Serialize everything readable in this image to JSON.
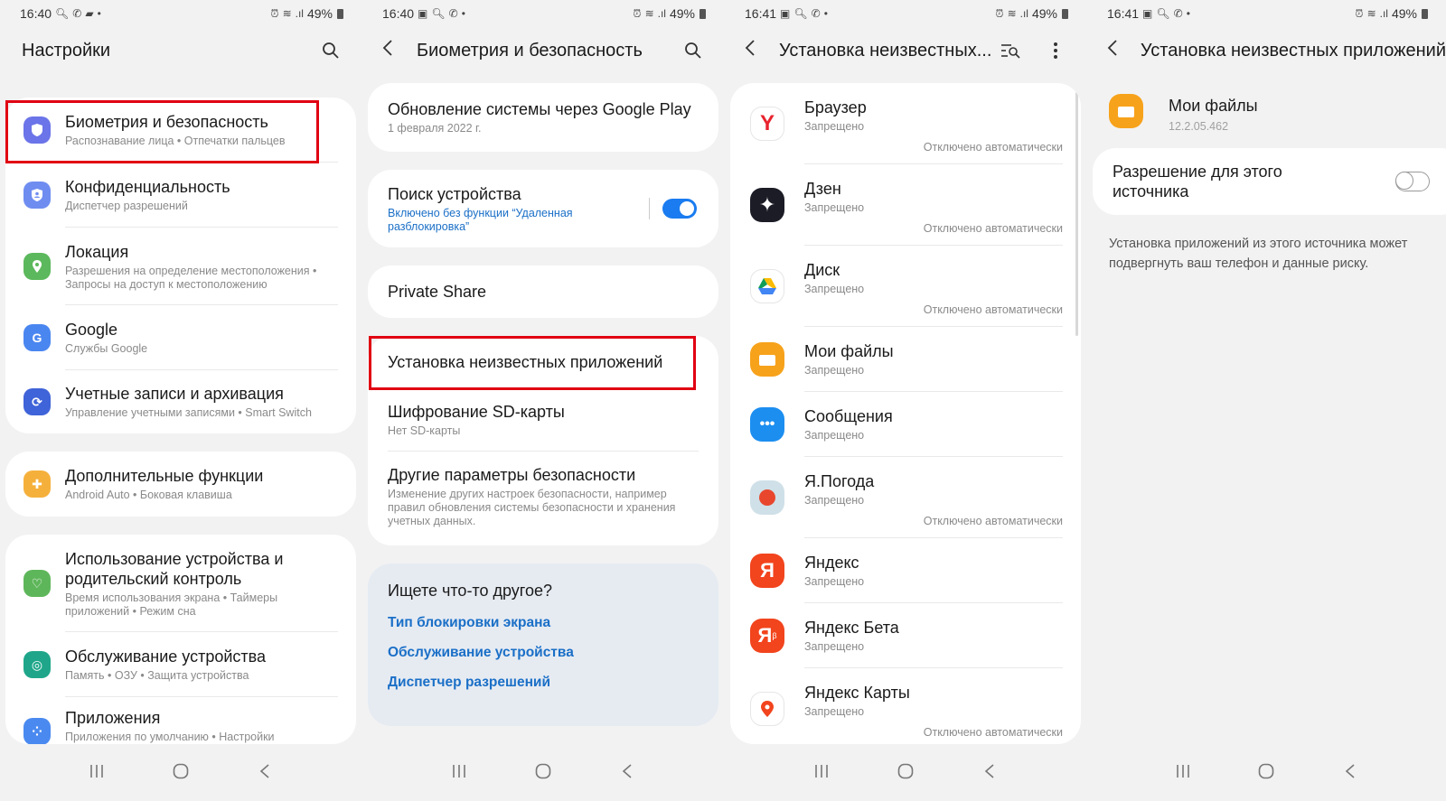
{
  "panels": [
    {
      "status": {
        "time": "16:40",
        "battery": "49%"
      },
      "title": "Настройки",
      "items": [
        {
          "title": "Биометрия и безопасность",
          "subtitle": "Распознавание лица  •  Отпечатки пальцев",
          "icon": "shield-icon",
          "color": "#6b74e8"
        },
        {
          "title": "Конфиденциальность",
          "subtitle": "Диспетчер разрешений",
          "icon": "privacy-icon",
          "color": "#6f8df0"
        },
        {
          "title": "Локация",
          "subtitle": "Разрешения на определение местоположения  •  Запросы на доступ к местоположению",
          "icon": "location-icon",
          "color": "#5cb85c"
        },
        {
          "title": "Google",
          "subtitle": "Службы Google",
          "icon": "google-icon",
          "color": "#4a86f0"
        },
        {
          "title": "Учетные записи и архивация",
          "subtitle": "Управление учетными записями  •  Smart Switch",
          "icon": "sync-icon",
          "color": "#3f63d8"
        },
        {
          "title": "Дополнительные функции",
          "subtitle": "Android Auto  •  Боковая клавиша",
          "icon": "gear-plus-icon",
          "color": "#f5b03c"
        },
        {
          "title": "Использование устройства и родительский контроль",
          "subtitle": "Время использования экрана  •  Таймеры приложений  •  Режим сна",
          "icon": "wellbeing-icon",
          "color": "#5eb65a"
        },
        {
          "title": "Обслуживание устройства",
          "subtitle": "Память  •  ОЗУ  •  Защита устройства",
          "icon": "care-icon",
          "color": "#1fa68a"
        },
        {
          "title": "Приложения",
          "subtitle": "Приложения по умолчанию  •  Настройки",
          "icon": "apps-icon",
          "color": "#4a8af0"
        }
      ]
    },
    {
      "status": {
        "time": "16:40",
        "battery": "49%"
      },
      "title": "Биометрия и безопасность",
      "gp_update": {
        "title": "Обновление системы через Google Play",
        "subtitle": "1 февраля 2022 г."
      },
      "find_device": {
        "title": "Поиск устройства",
        "subtitle": "Включено без функции “Удаленная разблокировка”",
        "enabled": true
      },
      "private_share": {
        "title": "Private Share"
      },
      "unknown_apps": {
        "title": "Установка неизвестных приложений"
      },
      "sd_encrypt": {
        "title": "Шифрование SD-карты",
        "subtitle": "Нет SD-карты"
      },
      "other_security": {
        "title": "Другие параметры безопасности",
        "subtitle": "Изменение других настроек безопасности, например правил обновления системы безопасности и хранения учетных данных."
      },
      "suggest": {
        "heading": "Ищете что-то другое?",
        "links": [
          "Тип блокировки экрана",
          "Обслуживание устройства",
          "Диспетчер разрешений"
        ]
      }
    },
    {
      "status": {
        "time": "16:41",
        "battery": "49%"
      },
      "title": "Установка неизвестных...",
      "apps": [
        {
          "name": "Браузер",
          "status": "Запрещено",
          "auto": "Отключено автоматически"
        },
        {
          "name": "Дзен",
          "status": "Запрещено",
          "auto": "Отключено автоматически"
        },
        {
          "name": "Диск",
          "status": "Запрещено",
          "auto": "Отключено автоматически"
        },
        {
          "name": "Мои файлы",
          "status": "Запрещено",
          "auto": ""
        },
        {
          "name": "Сообщения",
          "status": "Запрещено",
          "auto": ""
        },
        {
          "name": "Я.Погода",
          "status": "Запрещено",
          "auto": "Отключено автоматически"
        },
        {
          "name": "Яндекс",
          "status": "Запрещено",
          "auto": ""
        },
        {
          "name": "Яндекс Бета",
          "status": "Запрещено",
          "auto": ""
        },
        {
          "name": "Яндекс Карты",
          "status": "Запрещено",
          "auto": "Отключено автоматически"
        }
      ]
    },
    {
      "status": {
        "time": "16:41",
        "battery": "49%"
      },
      "title": "Установка неизвестных приложений",
      "app": {
        "name": "Мои файлы",
        "version": "12.2.05.462"
      },
      "permission": {
        "label": "Разрешение для этого источника",
        "enabled": false
      },
      "warning": "Установка приложений из этого источника может подвергнуть ваш телефон и данные риску."
    }
  ],
  "colors": {
    "accent": "#1a7cf0",
    "highlight": "#e00012",
    "link": "#1a6fc7"
  }
}
